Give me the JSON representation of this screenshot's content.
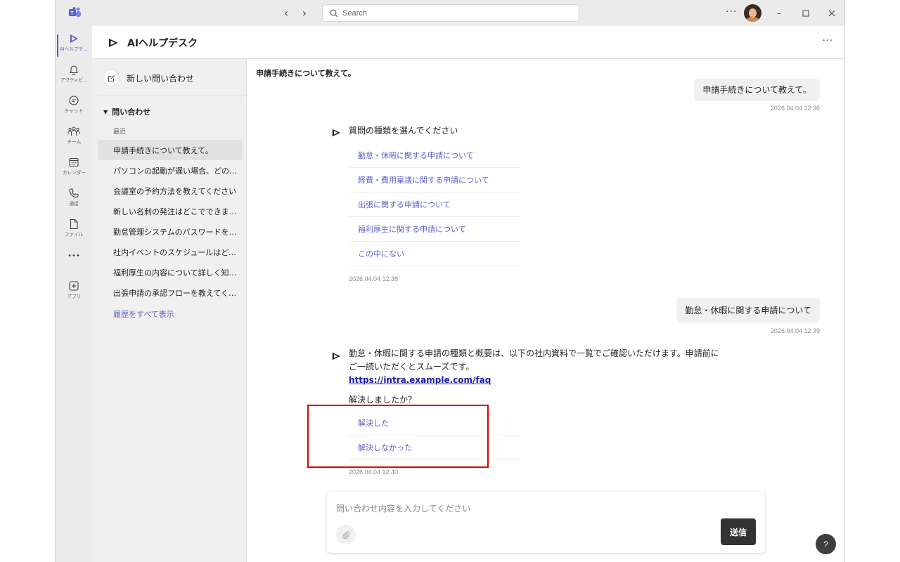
{
  "titlebar": {
    "search_placeholder": "Search",
    "more": "···"
  },
  "rail": {
    "items": [
      {
        "label": "AIヘルプデ...",
        "icon": "send-triangle-icon"
      },
      {
        "label": "アクティビ...",
        "icon": "bell-icon"
      },
      {
        "label": "チャット",
        "icon": "chat-icon"
      },
      {
        "label": "チーム",
        "icon": "teams-people-icon"
      },
      {
        "label": "カレンダー",
        "icon": "calendar-icon"
      },
      {
        "label": "通話",
        "icon": "phone-icon"
      },
      {
        "label": "ファイル",
        "icon": "file-icon"
      },
      {
        "label": "•••",
        "icon": "more-icon"
      },
      {
        "label": "アプリ",
        "icon": "add-app-icon"
      }
    ]
  },
  "header": {
    "title": "AIヘルプデスク",
    "more": "···"
  },
  "sidebar": {
    "new_inquiry": "新しい問い合わせ",
    "section": "問い合わせ",
    "recent": "最近",
    "history": [
      "申請手続きについて教えて。",
      "パソコンの起動が遅い場合、どのように対処すればよいですか",
      "会議室の予約方法を教えてください",
      "新しい名刺の発注はどこでできますか",
      "勤怠管理システムのパスワードを忘れました",
      "社内イベントのスケジュールはどこで確認できますか",
      "福利厚生の内容について詳しく知りたいです",
      "出張申請の承認フローを教えてください"
    ],
    "show_all": "履歴をすべて表示"
  },
  "chat": {
    "title": "申請手続きについて教えて。",
    "msg1": {
      "text": "申請手続きについて教えて。",
      "time": "2026.04.04 12:36"
    },
    "bot1": {
      "text": "質問の種類を選んでください",
      "choices": [
        "勤怠・休暇に関する申請について",
        "経費・費用稟議に関する申請について",
        "出張に関する申請について",
        "福利厚生に関する申請について",
        "この中にない"
      ],
      "time": "2026.04.04 12:38"
    },
    "msg2": {
      "text": "勤怠・休暇に関する申請について",
      "time": "2026.04.04 12:39"
    },
    "bot2": {
      "line1": "勤怠・休暇に関する申請の種類と概要は、以下の社内資料で一覧でご確認いただけます。申請前に",
      "line2": "ご一読いただくとスムーズです。",
      "link": "https://intra.example.com/faq",
      "question": "解決しましたか？",
      "choices": [
        "解決した",
        "解決しなかった"
      ],
      "time": "2026.04.04 12:40"
    }
  },
  "composer": {
    "placeholder": "問い合わせ内容を入力してください",
    "send": "送信"
  },
  "help": "?",
  "colors": {
    "accent": "#5b5fc7",
    "highlight": "#e00000",
    "send_button": "#333333"
  }
}
